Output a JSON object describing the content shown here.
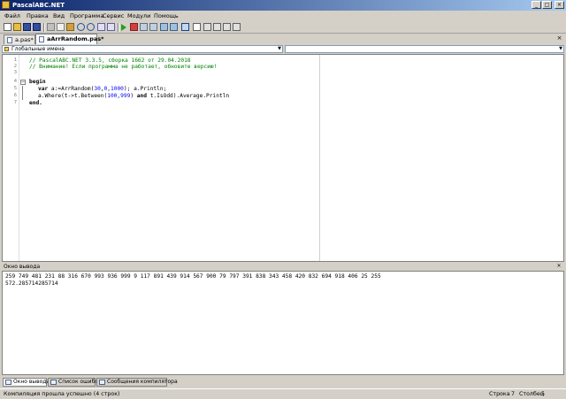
{
  "window": {
    "title": "PascalABC.NET",
    "minimize": "_",
    "maximize": "□",
    "close": "×"
  },
  "menu": [
    "Файл",
    "Правка",
    "Вид",
    "Программа",
    "Сервис",
    "Модули",
    "Помощь"
  ],
  "tabs": [
    {
      "label": "a.pas*",
      "active": false
    },
    {
      "label": "aArrRandom.pas*",
      "active": true
    }
  ],
  "tab_close": "×",
  "combos": {
    "left": "Глобальные имена",
    "right": ""
  },
  "editor": {
    "line_numbers": [
      "1",
      "2",
      "3",
      "4",
      "5",
      "6",
      "7"
    ],
    "comment1": "// PascalABC.NET 3.3.5, сборка 1662 от 29.04.2018",
    "comment2": "// Внимание! Если программа не работает, обновите версию!",
    "line4_kw": "begin",
    "line5_kw": "var",
    "line5_a": " a:=ArrRandom(",
    "line5_n1": "30",
    "line5_b": ",",
    "line5_n2": "0",
    "line5_c": ",",
    "line5_n3": "1000",
    "line5_d": "); a.Println;",
    "line6_a": "a.Where(t->t.Between(",
    "line6_n1": "100",
    "line6_b": ",",
    "line6_n2": "999",
    "line6_c": ") ",
    "line6_kw": "and",
    "line6_d": " t.IsOdd).Average.Println",
    "line7_kw": "end."
  },
  "output": {
    "title": "Окно вывода",
    "close": "×",
    "line1": "259 749 481 231 88 316 670 993 936 999 9 117 891 439 914 567 900 79 797 391 838 343 458 420 832 694 918 406 25 255",
    "line2": "572.285714285714"
  },
  "bottom_tabs": [
    "Окно вывода",
    "Список ошибок",
    "Сообщения компилятора"
  ],
  "status": {
    "message": "Компиляция прошла успешно (4 строк)",
    "row_label": "Строка",
    "row_value": "7",
    "col_label": "Столбец",
    "col_value": "5"
  },
  "colors": {
    "title_start": "#0a246a",
    "title_end": "#a6caf0",
    "comment": "#008000",
    "number": "#0000ff"
  }
}
